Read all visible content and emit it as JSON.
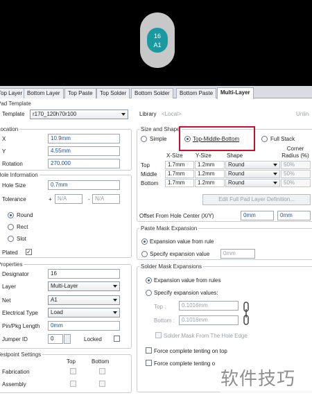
{
  "preview": {
    "pad_number": "16",
    "pad_net": "A1"
  },
  "tabs": [
    "Top Layer",
    "Bottom Layer",
    "Top Paste",
    "Top Solder",
    "Bottom Solder",
    "Bottom Paste",
    "Multi-Layer"
  ],
  "pad_template": {
    "section": "Pad Template",
    "template_label": "Template",
    "template_value": "r170_120h70r100",
    "library_label": "Library",
    "library_value": "<Local>",
    "library_status": "Unlin"
  },
  "location": {
    "section": "Location",
    "x_label": "X",
    "x_value": "10.9mm",
    "y_label": "Y",
    "y_value": "4.55mm",
    "rotation_label": "Rotation",
    "rotation_value": "270.000"
  },
  "hole_info": {
    "section": "Hole Information",
    "size_label": "Hole Size",
    "size_value": "0.7mm",
    "tolerance_label": "Tolerance",
    "plus": "+",
    "plus_value": "N/A",
    "minus": "-",
    "minus_value": "N/A",
    "shapes": [
      "Round",
      "Rect",
      "Slot"
    ],
    "plated_label": "Plated",
    "plated_check": "✓"
  },
  "properties": {
    "section": "Properties",
    "designator_label": "Designator",
    "designator_value": "16",
    "layer_label": "Layer",
    "layer_value": "Multi-Layer",
    "net_label": "Net",
    "net_value": "A1",
    "etype_label": "Electrical Type",
    "etype_value": "Load",
    "pinlen_label": "Pin/Pkg Length",
    "pinlen_value": "0mm",
    "jumper_label": "Jumper ID",
    "jumper_value": "0",
    "locked_label": "Locked"
  },
  "testpoint": {
    "section": "Testpoint Settings",
    "top": "Top",
    "bottom": "Bottom",
    "fabrication": "Fabrication",
    "assembly": "Assembly"
  },
  "size_shape": {
    "section": "Size and Shape",
    "simple": "Simple",
    "tmb": "Top-Middle-Bottom",
    "full": "Full Stack",
    "col_x": "X-Size",
    "col_y": "Y-Size",
    "col_shape": "Shape",
    "col_radius": "Corner Radius (%)",
    "rows": [
      {
        "name": "Top",
        "x": "1.7mm",
        "y": "1.2mm",
        "shape": "Round",
        "radius": "50%"
      },
      {
        "name": "Middle",
        "x": "1.7mm",
        "y": "1.2mm",
        "shape": "Round",
        "radius": "50%"
      },
      {
        "name": "Bottom",
        "x": "1.7mm",
        "y": "1.2mm",
        "shape": "Round",
        "radius": "50%"
      }
    ],
    "edit_button": "Edit Full Pad Layer Definition...",
    "offset_label": "Offset From Hole Center (X/Y)",
    "offset_x": "0mm",
    "offset_y": "0mm"
  },
  "paste_mask": {
    "section": "Paste Mask Expansion",
    "opt1": "Expansion value from rule",
    "opt2": "Specify expansion value",
    "value": "0mm"
  },
  "solder_mask": {
    "section": "Solder Mask Expansions",
    "opt1": "Expansion value from rules",
    "opt2": "Specify expansion values:",
    "top_label": "Top :",
    "top_value": "0.1016mm",
    "bottom_label": "Bottom :",
    "bottom_value": "0.1016mm",
    "from_edge": "Solder Mask From The Hole Edge",
    "tent_top": "Force complete tenting on top",
    "tent_bottom": "Force complete tenting o"
  },
  "watermark": "软件技巧",
  "colors": {
    "highlight": "#c8102e",
    "pad_hole": "#1a9aa0",
    "field_text": "#1d4fa3"
  }
}
